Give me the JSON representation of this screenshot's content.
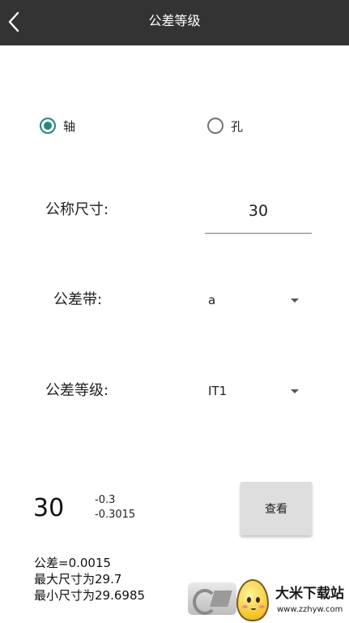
{
  "app": {
    "title": "公差等级",
    "back_icon": "chevron-left-icon"
  },
  "colors": {
    "titlebar": "#333333",
    "accent": "#1f8a7c",
    "button": "#dedede"
  },
  "type_selector": {
    "options": [
      {
        "label": "轴",
        "checked": true
      },
      {
        "label": "孔",
        "checked": false
      }
    ]
  },
  "form": {
    "nominal_size_label": "公称尺寸:",
    "nominal_size_value": "30",
    "tolerance_zone_label": "公差带:",
    "tolerance_zone_value": "a",
    "tolerance_grade_label": "公差等级:",
    "tolerance_grade_value": "IT1"
  },
  "result": {
    "size": "30",
    "upper_deviation": "-0.3",
    "lower_deviation": "-0.3015",
    "view_button_label": "查看",
    "tolerance_text": "公差=0.0015",
    "max_size_text": "最大尺寸为29.7",
    "min_size_text": "最小尺寸为29.6985"
  },
  "watermark": {
    "site_name": "大米下载站",
    "site_url": "www.zzhyw.com"
  }
}
